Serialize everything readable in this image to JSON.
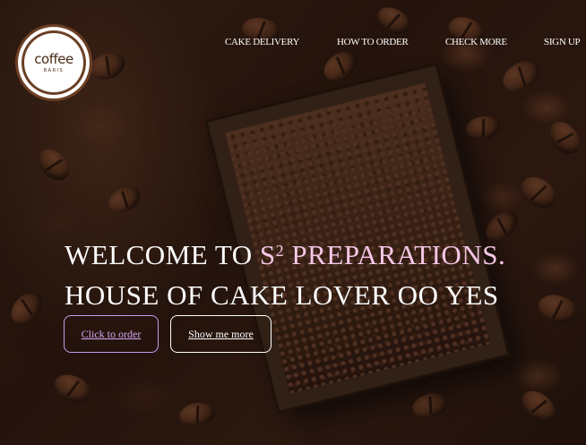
{
  "logo": {
    "word": "coffee",
    "subword": "BARIS"
  },
  "nav": {
    "items": [
      {
        "label": "CAKE DELIVERY"
      },
      {
        "label": "HOW TO ORDER"
      },
      {
        "label": "CHECK MORE"
      },
      {
        "label": "SIGN UP"
      }
    ]
  },
  "hero": {
    "line1_prefix": "WELCOME TO ",
    "line1_brand": "S",
    "line1_brand_sup": "2",
    "line1_brand_rest": " PREPARATIONS.",
    "line2": "HOUSE OF CAKE LOVER OO YES",
    "order_button": "Click to order",
    "more_button": "Show me more"
  },
  "colors": {
    "accent_pink": "#f4c7e6",
    "accent_purple": "#d7a6f5",
    "logo_brown": "#6b3f25"
  }
}
